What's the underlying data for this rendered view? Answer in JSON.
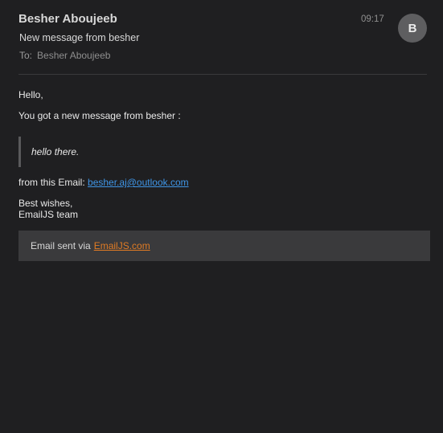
{
  "header": {
    "sender_name": "Besher Aboujeeb",
    "subject": "New message from besher",
    "to_label": "To:",
    "to_name": "Besher Aboujeeb",
    "time": "09:17",
    "avatar_initial": "B"
  },
  "message": {
    "greeting": "Hello,",
    "intro": "You got a new message from besher :",
    "quote": "hello there.",
    "from_email_label": "from this Email:",
    "from_email_link": "besher.aj@outlook.com",
    "signoff_line1": "Best wishes,",
    "signoff_line2": "EmailJS team"
  },
  "footer": {
    "text": "Email sent via",
    "link": "EmailJS.com"
  },
  "colors": {
    "background": "#1f1f21",
    "link_blue": "#3f95e6",
    "link_orange": "#e07b24",
    "footer_bg": "#3a3a3c",
    "avatar_bg": "#5e5e60"
  }
}
